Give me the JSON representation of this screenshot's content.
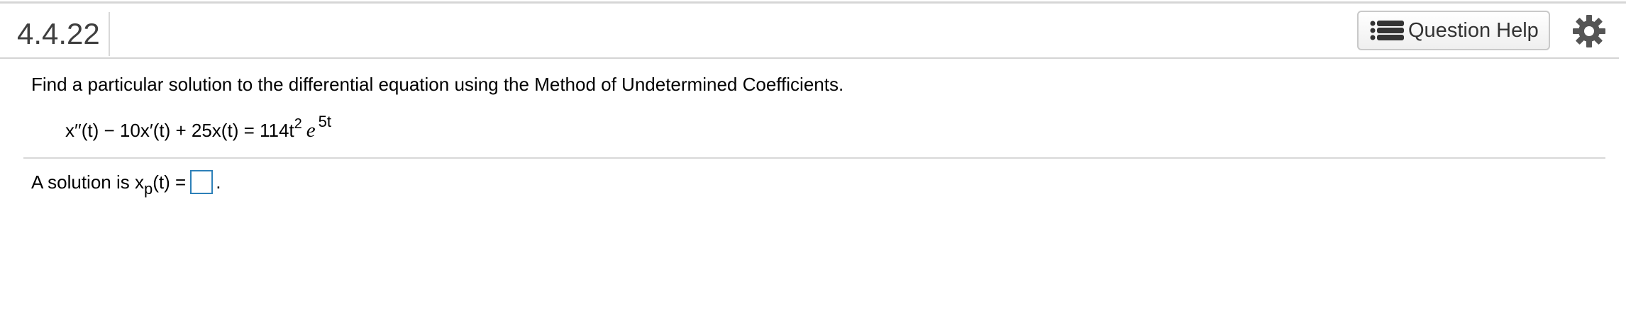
{
  "header": {
    "question_number": "4.4.22",
    "help_button_label": "Question Help",
    "help_icon": "list-icon",
    "settings_icon": "gear-icon"
  },
  "problem": {
    "prompt": "Find a particular solution to the differential equation using the Method of Undetermined Coefficients.",
    "equation": {
      "lhs_and_coef": "x′′(t) − 10x′(t) + 25x(t) = 114t",
      "t_exponent": "2",
      "e_symbol": "e",
      "e_exponent": "5t"
    }
  },
  "answer": {
    "prefix": "A solution is x",
    "subscript": "p",
    "suffix": "(t) =",
    "input_value": "",
    "period": "."
  },
  "colors": {
    "input_border": "#2d80b8",
    "divider": "#d8d8d8",
    "question_number": "#3f3f3f"
  }
}
